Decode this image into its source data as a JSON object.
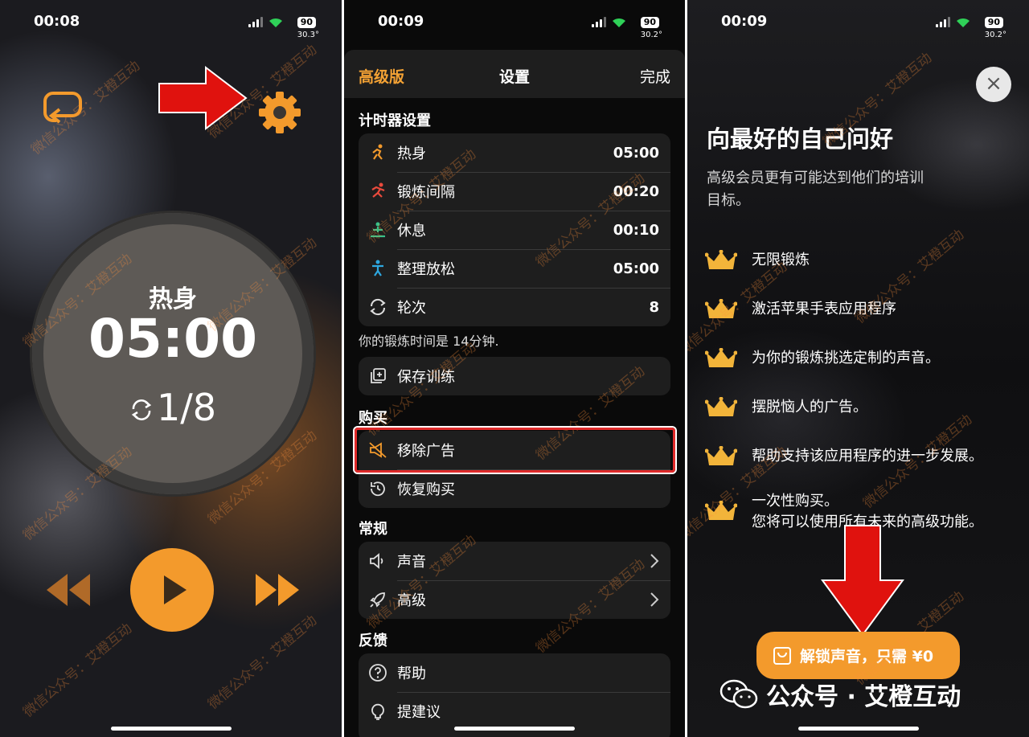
{
  "watermark": "微信公众号：艾橙互动",
  "p1": {
    "time": "00:08",
    "battery": "90",
    "temp": "30.3°",
    "phase": "热身",
    "timer": "05:00",
    "round": "1/8"
  },
  "p2": {
    "time": "00:09",
    "battery": "90",
    "temp": "30.2°",
    "header": {
      "left": "高级版",
      "title": "设置",
      "right": "完成"
    },
    "timer_section": "计时器设置",
    "timer_rows": [
      {
        "label": "热身",
        "value": "05:00"
      },
      {
        "label": "锻炼间隔",
        "value": "00:20"
      },
      {
        "label": "休息",
        "value": "00:10"
      },
      {
        "label": "整理放松",
        "value": "05:00"
      },
      {
        "label": "轮次",
        "value": "8"
      }
    ],
    "note": "你的锻炼时间是 14分钟.",
    "save": "保存训练",
    "purchase_section": "购买",
    "remove_ads": "移除广告",
    "restore": "恢复购买",
    "general_section": "常规",
    "sound": "声音",
    "advanced": "高级",
    "feedback_section": "反馈",
    "help": "帮助",
    "suggest": "提建议"
  },
  "p3": {
    "time": "00:09",
    "battery": "90",
    "temp": "30.2°",
    "title": "向最好的自己问好",
    "subtitle": "高级会员更有可能达到他们的培训目标。",
    "features": [
      "无限锻炼",
      "激活苹果手表应用程序",
      "为你的锻炼挑选定制的声音。",
      "摆脱恼人的广告。",
      "帮助支持该应用程序的进一步发展。"
    ],
    "feature_last_1": "一次性购买。",
    "feature_last_2": "您将可以使用所有未来的高级功能。",
    "unlock": "解锁声音，只需 ¥0",
    "wechat": "公众号 · 艾橙互动"
  },
  "colors": {
    "accent": "#f39a2c",
    "red": "#e02a2a"
  }
}
